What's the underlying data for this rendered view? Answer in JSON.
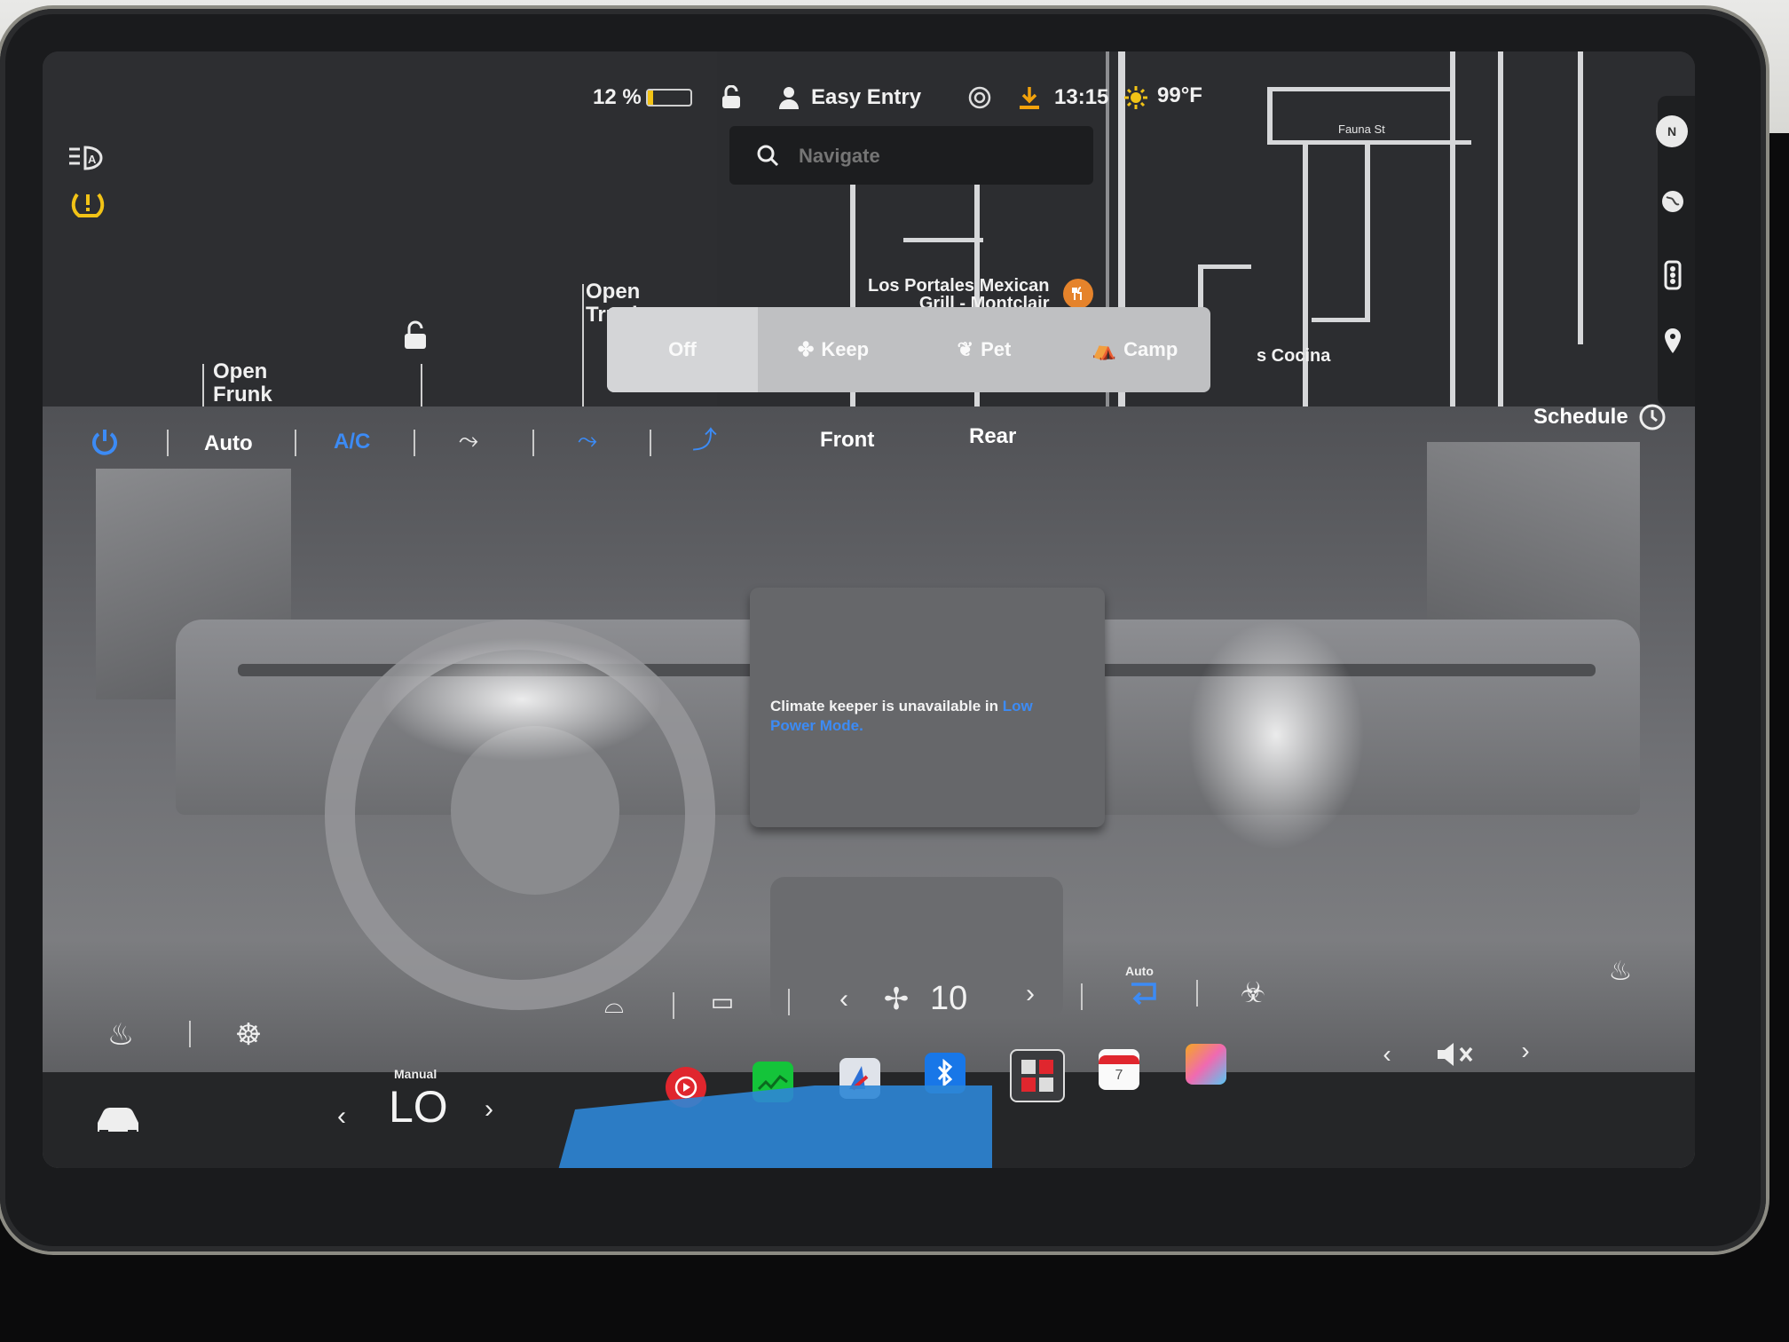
{
  "status": {
    "battery_percent": "12 %",
    "profile": "Easy Entry",
    "time": "13:15",
    "temperature": "99°F"
  },
  "search": {
    "placeholder": "Navigate"
  },
  "map": {
    "street_label": "Fauna St",
    "poi_name_line1": "Los Portales Mexican",
    "poi_name_line2": "Grill - Montclair",
    "poi_partial": "s Cocina"
  },
  "car": {
    "frunk_line1": "Open",
    "frunk_line2": "Frunk",
    "trunk_line1": "Open",
    "trunk_line2": "Trunk"
  },
  "keeper": {
    "options": [
      "Off",
      "Keep",
      "Pet",
      "Camp"
    ],
    "selected": "Off"
  },
  "climate_toolbar": {
    "auto_label": "Auto",
    "ac_label": "A/C",
    "front_label": "Front",
    "rear_label": "Rear",
    "schedule_label": "Schedule"
  },
  "message": {
    "text": "Climate keeper is unavailable in ",
    "link": "Low Power Mode."
  },
  "fan": {
    "speed": "10",
    "recirc_label": "Auto"
  },
  "dock": {
    "temp_mode": "Manual",
    "temp_value": "LO",
    "calendar_day": "7"
  },
  "colors": {
    "accent_blue": "#3c8bf5",
    "warning_yellow": "#f2c316",
    "red": "#e0262e",
    "green": "#14c43a"
  }
}
